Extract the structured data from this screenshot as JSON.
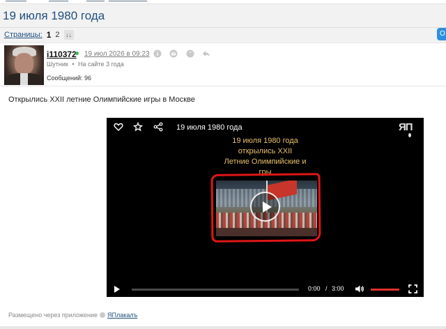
{
  "page": {
    "title": "19 июля 1980 года"
  },
  "pagination": {
    "label": "Страницы:",
    "current": "1",
    "next": "2",
    "sort_glyph": "↓↓"
  },
  "right_button": {
    "label": "О"
  },
  "post": {
    "author": "i110372",
    "date": "19 июл 2026 в 09:23",
    "role": "Шутник",
    "role_sep": "•",
    "tenure": "На сайте 3 года",
    "messages": "Сообщений: 96",
    "text": "Открылись XXII летние Олимпийские игры в Москве",
    "action_icons": [
      "info-icon",
      "mail-icon",
      "quote-icon",
      "reply-icon"
    ]
  },
  "video": {
    "title": "19 июля 1980 года",
    "logo": "ЯП",
    "caption_lines": [
      "19 июля 1980 года",
      "открылись XXII",
      "Летние Олимпийские и",
      "гры"
    ],
    "current_time": "0:00",
    "time_separator": "/",
    "duration": "3:00",
    "volume_level": 1.0,
    "progress": 0.0,
    "icons": [
      "heart-icon",
      "star-icon",
      "share-icon",
      "play-icon",
      "volume-icon",
      "fullscreen-icon"
    ]
  },
  "footer": {
    "via_prefix": "Размещено через приложение",
    "app_name": "ЯПлакалъ"
  },
  "colors": {
    "link": "#1f4f7d",
    "online": "#3cba54",
    "caption": "#e8c06a",
    "annotation": "#e01616",
    "volume": "#e0312b",
    "pill": "#2d8fe0"
  }
}
